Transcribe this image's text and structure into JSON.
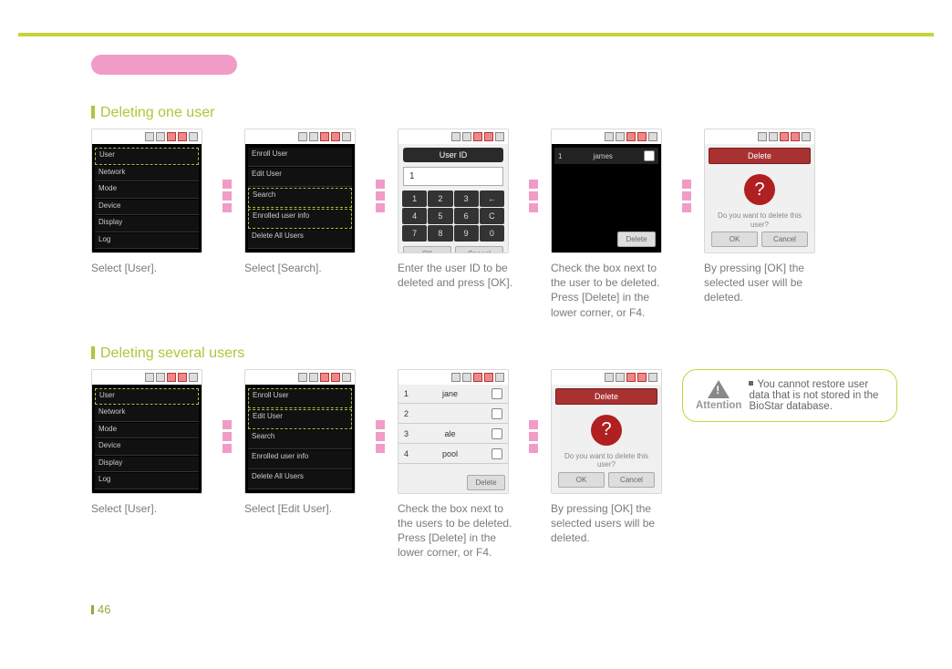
{
  "page_number": "46",
  "section1": {
    "title": "Deleting one user",
    "steps": [
      "Select [User].",
      "Select [Search].",
      "Enter the user ID to be deleted and press [OK].",
      "Check the box next to the user to be deleted. Press [Delete] in the lower corner, or F4.",
      "By pressing [OK] the selected user will be deleted."
    ],
    "menu1": [
      "User",
      "Network",
      "Mode",
      "Device",
      "Display",
      "Log"
    ],
    "menu2": [
      "Enroll User",
      "Edit User",
      "Search",
      "Enrolled user info",
      "Delete All Users"
    ],
    "keypad_header": "User ID",
    "id_value": "1",
    "keys": [
      "1",
      "2",
      "3",
      "←",
      "4",
      "5",
      "6",
      "C",
      "7",
      "8",
      "9",
      "0"
    ],
    "btns": [
      "OK",
      "Cancel"
    ],
    "user_row": {
      "id": "1",
      "name": "james"
    },
    "dialog": {
      "title": "Delete",
      "text": "Do you want to delete this user?",
      "ok": "OK",
      "cancel": "Cancel"
    }
  },
  "section2": {
    "title": "Deleting several users",
    "steps": [
      "Select [User].",
      "Select [Edit User].",
      "Check the box next to the users to be deleted. Press [Delete] in the lower corner, or F4.",
      "By pressing [OK] the selected users will be deleted."
    ],
    "userlist": [
      {
        "id": "1",
        "name": "jane"
      },
      {
        "id": "2",
        "name": ""
      },
      {
        "id": "3",
        "name": "ale"
      },
      {
        "id": "4",
        "name": "pool"
      }
    ],
    "note": {
      "label": "Attention",
      "text": "You cannot restore user data that is not stored in the BioStar database."
    }
  }
}
